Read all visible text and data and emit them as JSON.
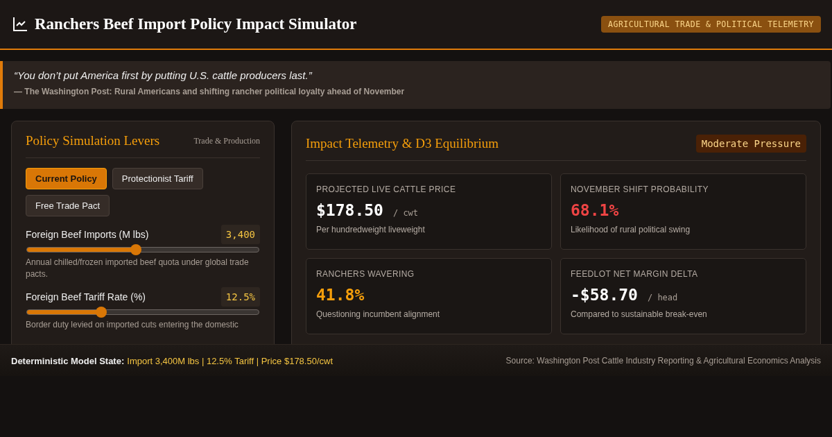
{
  "header": {
    "title": "Ranchers Beef Import Policy Impact Simulator",
    "badge": "AGRICULTURAL TRADE & POLITICAL TELEMETRY"
  },
  "quote": {
    "text": "“You don’t put America first by putting U.S. cattle producers last.”",
    "source": "— The Washington Post: Rural Americans and shifting rancher political loyalty ahead of November"
  },
  "levers": {
    "title": "Policy Simulation Levers",
    "subtitle": "Trade & Production",
    "presets": [
      {
        "label": "Current Policy",
        "selected": true
      },
      {
        "label": "Protectionist Tariff",
        "selected": false
      },
      {
        "label": "Free Trade Pact",
        "selected": false
      }
    ],
    "sliders": [
      {
        "label": "Foreign Beef Imports (M lbs)",
        "reading": "3,400",
        "level": 0.47,
        "note": "Annual chilled/frozen imported beef quota under global trade pacts."
      },
      {
        "label": "Foreign Beef Tariff Rate (%)",
        "reading": "12.5%",
        "level": 0.32,
        "note": "Border duty levied on imported cuts entering the domestic"
      }
    ]
  },
  "impact": {
    "title": "Impact Telemetry & D3 Equilibrium",
    "status": "Moderate Pressure",
    "metrics": [
      {
        "label": "PROJECTED LIVE CATTLE PRICE",
        "value": "$178.50",
        "unit": "/ cwt",
        "note": "Per hundredweight liveweight",
        "color": "#ffffff"
      },
      {
        "label": "NOVEMBER SHIFT PROBABILITY",
        "value": "68.1%",
        "note": "Likelihood of rural political swing",
        "color": "#ef4444"
      },
      {
        "label": "RANCHERS WAVERING",
        "value": "41.8%",
        "note": "Questioning incumbent alignment",
        "color": "#f59e0b"
      },
      {
        "label": "FEEDLOT NET MARGIN DELTA",
        "value": "-$58.70",
        "unit": "/ head",
        "note": "Compared to sustainable break-even",
        "color": "#ffffff"
      }
    ]
  },
  "footer": {
    "label": "Deterministic Model State:",
    "state": "Import 3,400M lbs | 12.5% Tariff | Price $178.50/cwt",
    "source": "Source: Washington Post Cattle Industry Reporting & Agricultural Economics Analysis"
  }
}
